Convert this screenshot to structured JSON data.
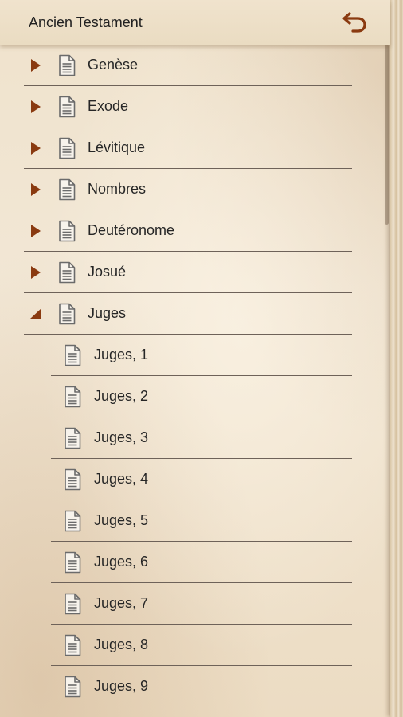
{
  "header": {
    "title": "Ancien Testament",
    "back_icon": "undo-arrow-icon"
  },
  "books": [
    {
      "label": "Genèse",
      "expanded": false
    },
    {
      "label": "Exode",
      "expanded": false
    },
    {
      "label": "Lévitique",
      "expanded": false
    },
    {
      "label": "Nombres",
      "expanded": false
    },
    {
      "label": "Deutéronome",
      "expanded": false
    },
    {
      "label": "Josué",
      "expanded": false
    },
    {
      "label": "Juges",
      "expanded": true
    }
  ],
  "chapters": [
    {
      "label": "Juges, 1"
    },
    {
      "label": "Juges, 2"
    },
    {
      "label": "Juges, 3"
    },
    {
      "label": "Juges, 4"
    },
    {
      "label": "Juges, 5"
    },
    {
      "label": "Juges, 6"
    },
    {
      "label": "Juges, 7"
    },
    {
      "label": "Juges, 8"
    },
    {
      "label": "Juges, 9"
    }
  ],
  "colors": {
    "accent": "#8a3a10",
    "text": "#262626",
    "divider": "#6e6259",
    "icon_stroke": "#6b6b6b"
  }
}
